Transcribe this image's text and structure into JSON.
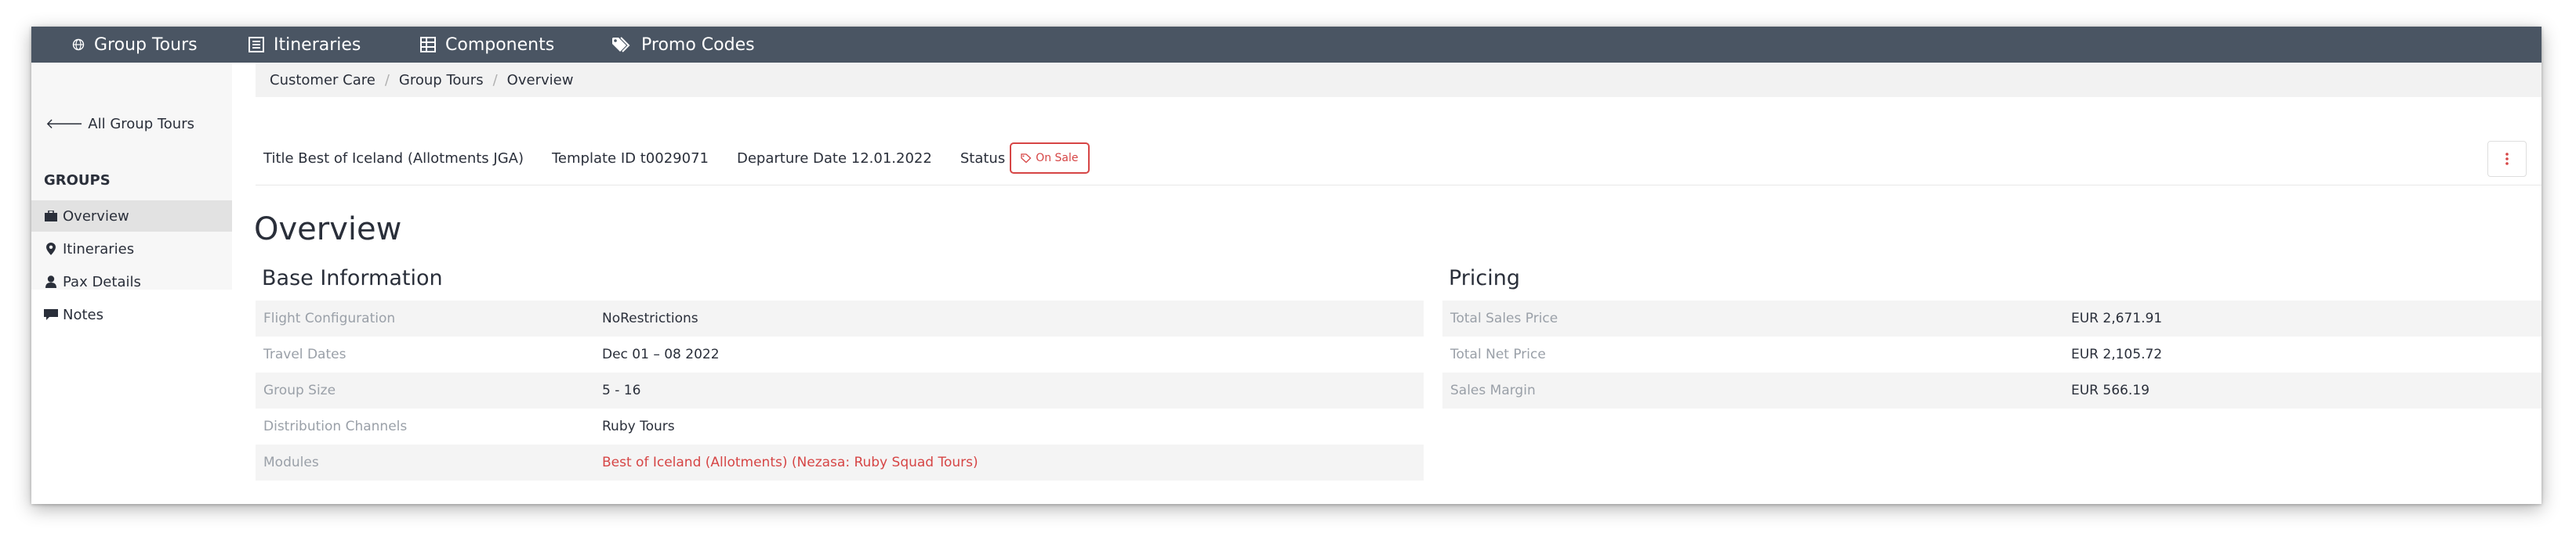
{
  "nav": {
    "items": [
      {
        "label": "Group Tours",
        "icon": "globe-icon"
      },
      {
        "label": "Itineraries",
        "icon": "list-icon"
      },
      {
        "label": "Components",
        "icon": "table-icon"
      },
      {
        "label": "Promo Codes",
        "icon": "tags-icon"
      }
    ]
  },
  "sidebar": {
    "back_label": "All Group Tours",
    "groups_heading": "GROUPS",
    "items": [
      {
        "label": "Overview",
        "icon": "briefcase-icon",
        "active": true
      },
      {
        "label": "Itineraries",
        "icon": "map-marker-icon"
      },
      {
        "label": "Pax Details",
        "icon": "user-icon"
      },
      {
        "label": "Notes",
        "icon": "comment-icon"
      }
    ]
  },
  "breadcrumb": [
    "Customer Care",
    "Group Tours",
    "Overview"
  ],
  "info": {
    "title": "Title Best of Iceland (Allotments JGA)",
    "template_id": "Template ID t0029071",
    "departure_date": "Departure Date 12.01.2022",
    "status_label": "Status",
    "status_badge": "On Sale"
  },
  "page_title": "Overview",
  "base_info": {
    "title": "Base Information",
    "rows": [
      {
        "label": "Flight Configuration",
        "value": "NoRestrictions"
      },
      {
        "label": "Travel Dates",
        "value": "Dec 01 – 08 2022"
      },
      {
        "label": "Group Size",
        "value": "5 - 16"
      },
      {
        "label": "Distribution Channels",
        "value": "Ruby Tours"
      },
      {
        "label": "Modules",
        "value": "Best of Iceland (Allotments) (Nezasa: Ruby Squad Tours)"
      }
    ]
  },
  "pricing": {
    "title": "Pricing",
    "rows": [
      {
        "label": "Total Sales Price",
        "value": "EUR 2,671.91"
      },
      {
        "label": "Total Net Price",
        "value": "EUR 2,105.72"
      },
      {
        "label": "Sales Margin",
        "value": "EUR 566.19"
      }
    ]
  },
  "colors": {
    "nav_bg": "#4a5563",
    "accent_red": "#d64545",
    "label_gray": "#9aa0a8"
  }
}
